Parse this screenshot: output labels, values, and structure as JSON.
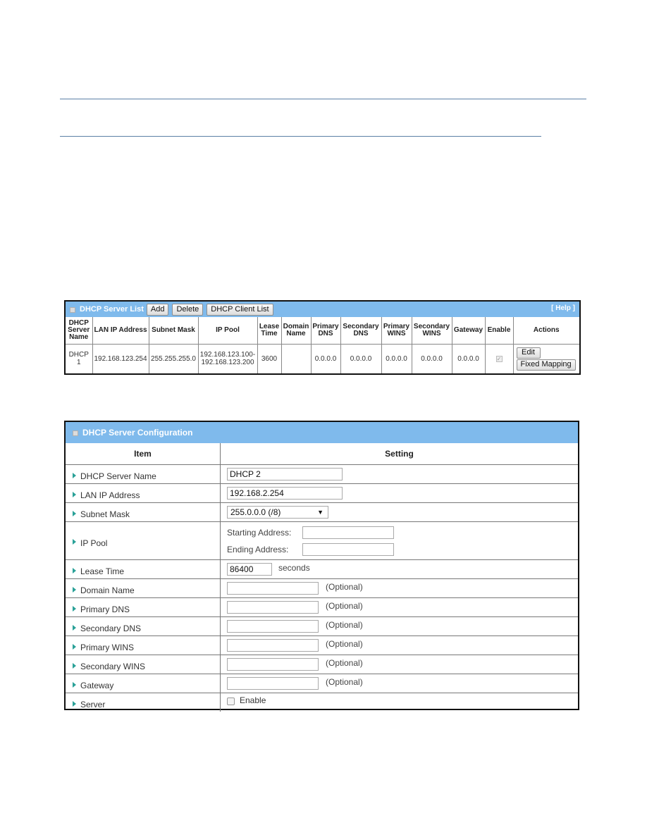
{
  "server_list": {
    "title": "DHCP Server List",
    "buttons": {
      "add": "Add",
      "delete": "Delete",
      "client_list": "DHCP Client List"
    },
    "help": "[ Help ]",
    "columns": [
      "DHCP Server Name",
      "LAN IP Address",
      "Subnet Mask",
      "IP Pool",
      "Lease Time",
      "Domain Name",
      "Primary DNS",
      "Secondary DNS",
      "Primary WINS",
      "Secondary WINS",
      "Gateway",
      "Enable",
      "Actions"
    ],
    "rows": [
      {
        "name": "DHCP 1",
        "lan_ip": "192.168.123.254",
        "subnet_mask": "255.255.255.0",
        "ip_pool_start": "192.168.123.100-",
        "ip_pool_end": "192.168.123.200",
        "lease_time": "3600",
        "domain_name": "",
        "primary_dns": "0.0.0.0",
        "secondary_dns": "0.0.0.0",
        "primary_wins": "0.0.0.0",
        "secondary_wins": "0.0.0.0",
        "gateway": "0.0.0.0",
        "enabled": true,
        "actions": {
          "edit": "Edit",
          "fixed_mapping": "Fixed Mapping"
        }
      }
    ]
  },
  "config": {
    "title": "DHCP Server Configuration",
    "header": {
      "item": "Item",
      "setting": "Setting"
    },
    "fields": {
      "server_name": {
        "label": "DHCP Server Name",
        "value": "DHCP 2"
      },
      "lan_ip": {
        "label": "LAN IP Address",
        "value": "192.168.2.254"
      },
      "subnet_mask": {
        "label": "Subnet Mask",
        "selected": "255.0.0.0 (/8)"
      },
      "ip_pool": {
        "label": "IP Pool",
        "start_label": "Starting Address:",
        "start_value": "",
        "end_label": "Ending Address:",
        "end_value": ""
      },
      "lease_time": {
        "label": "Lease Time",
        "value": "86400",
        "unit": "seconds"
      },
      "domain_name": {
        "label": "Domain Name",
        "value": "",
        "hint": "(Optional)"
      },
      "primary_dns": {
        "label": "Primary DNS",
        "value": "",
        "hint": "(Optional)"
      },
      "secondary_dns": {
        "label": "Secondary DNS",
        "value": "",
        "hint": "(Optional)"
      },
      "primary_wins": {
        "label": "Primary WINS",
        "value": "",
        "hint": "(Optional)"
      },
      "secondary_wins": {
        "label": "Secondary WINS",
        "value": "",
        "hint": "(Optional)"
      },
      "gateway": {
        "label": "Gateway",
        "value": "",
        "hint": "(Optional)"
      },
      "server": {
        "label": "Server",
        "checkbox_label": "Enable",
        "checked": false
      }
    }
  },
  "colors": {
    "panel_header": "#7fbaec",
    "arrow": "#2aa198",
    "rule": "#5b7fa6"
  }
}
